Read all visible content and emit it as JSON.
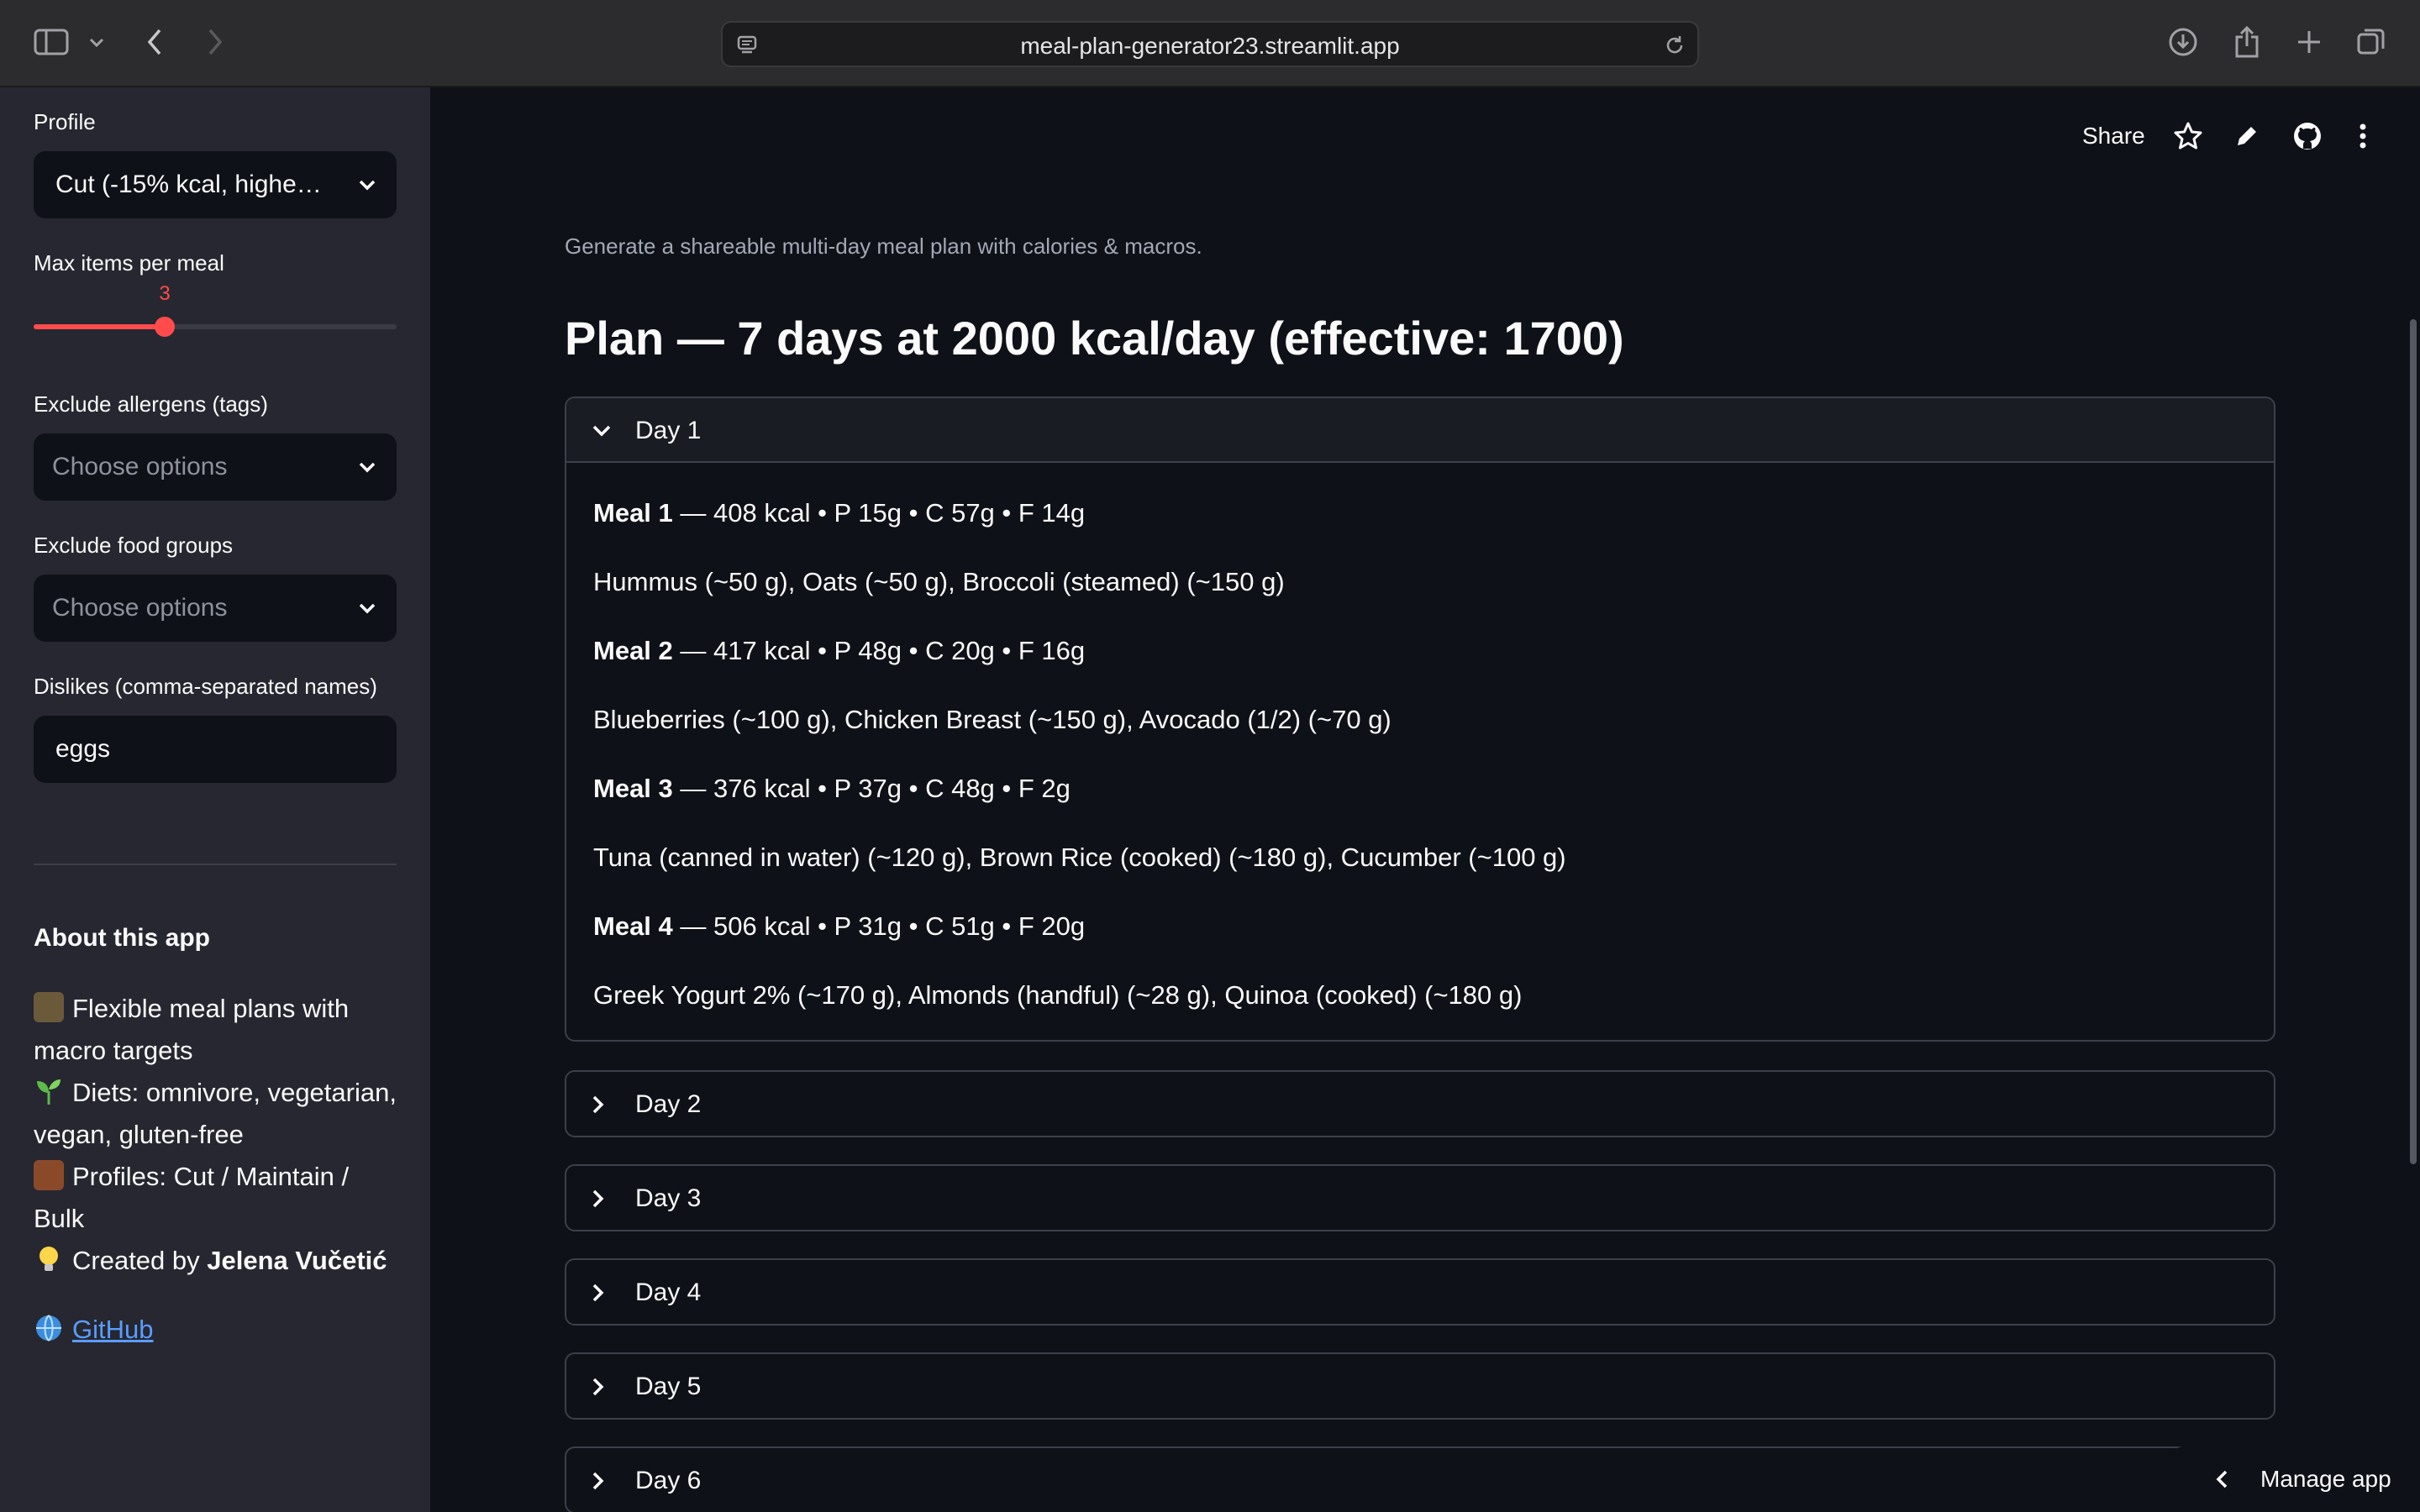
{
  "browser": {
    "url": "meal-plan-generator23.streamlit.app",
    "icons": [
      "sidebar-toggle-icon",
      "chevron-down-icon",
      "back-arrow-icon",
      "forward-arrow-icon",
      "site-settings-icon",
      "reload-icon",
      "download-icon",
      "share-icon",
      "new-tab-icon",
      "tab-overview-icon"
    ]
  },
  "sidebar": {
    "profile": {
      "label": "Profile",
      "value": "Cut (-15% kcal, highe…"
    },
    "max_items": {
      "label": "Max items per meal",
      "value": "3",
      "fraction": 0.36
    },
    "allergens": {
      "label": "Exclude allergens (tags)",
      "placeholder": "Choose options"
    },
    "food_groups": {
      "label": "Exclude food groups",
      "placeholder": "Choose options"
    },
    "dislikes": {
      "label": "Dislikes (comma-separated names)",
      "value": "eggs"
    },
    "about": {
      "title": "About this app",
      "line1a": "Flexible meal plans with",
      "line1b": "macro targets",
      "line2a": "Diets: omnivore, vegetarian,",
      "line2b": "vegan, gluten-free",
      "line3a": "Profiles: Cut / Maintain /",
      "line3b": "Bulk",
      "line4_prefix": "Created by",
      "line4_name": "Jelena Vučetić",
      "github": "GitHub"
    }
  },
  "toolbar": {
    "share": "Share"
  },
  "main": {
    "subtitle": "Generate a shareable multi-day meal plan with calories & macros.",
    "title": "Plan — 7 days at 2000 kcal/day (effective: 1700)",
    "days": [
      {
        "label": "Day 1",
        "expanded": true,
        "meals": [
          {
            "name": "Meal 1",
            "summary": " — 408 kcal • P 15g • C 57g • F 14g",
            "items": "Hummus (~50 g), Oats (~50 g), Broccoli (steamed) (~150 g)"
          },
          {
            "name": "Meal 2",
            "summary": " — 417 kcal • P 48g • C 20g • F 16g",
            "items": "Blueberries (~100 g), Chicken Breast (~150 g), Avocado (1/2) (~70 g)"
          },
          {
            "name": "Meal 3",
            "summary": " — 376 kcal • P 37g • C 48g • F 2g",
            "items": "Tuna (canned in water) (~120 g), Brown Rice (cooked) (~180 g), Cucumber (~100 g)"
          },
          {
            "name": "Meal 4",
            "summary": " — 506 kcal • P 31g • C 51g • F 20g",
            "items": "Greek Yogurt 2% (~170 g), Almonds (handful) (~28 g), Quinoa (cooked) (~180 g)"
          }
        ]
      },
      {
        "label": "Day 2"
      },
      {
        "label": "Day 3"
      },
      {
        "label": "Day 4"
      },
      {
        "label": "Day 5"
      },
      {
        "label": "Day 6"
      }
    ]
  },
  "manage_app": "Manage app"
}
